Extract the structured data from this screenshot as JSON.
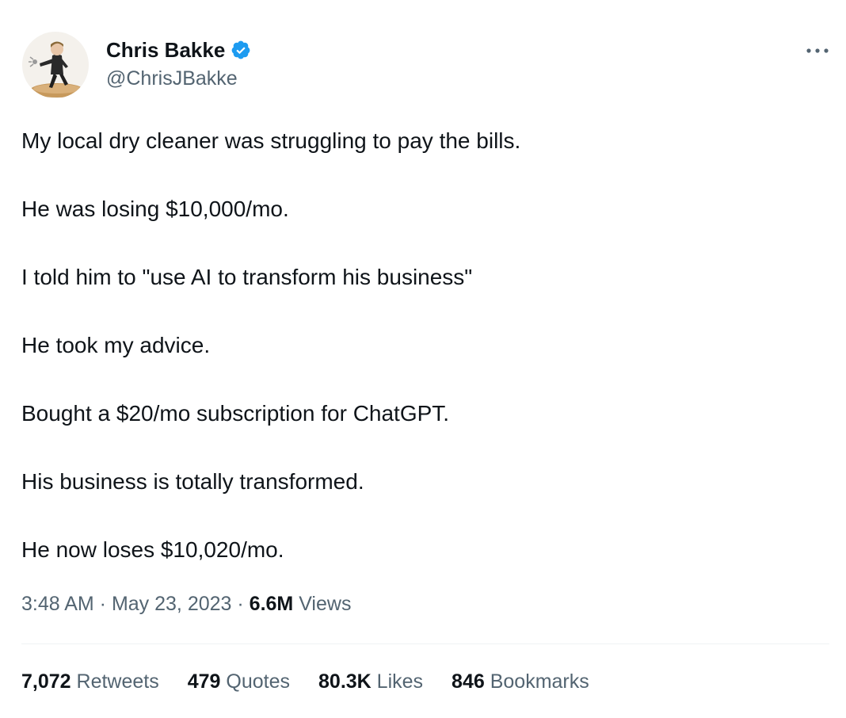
{
  "author": {
    "display_name": "Chris Bakke",
    "handle": "@ChrisJBakke",
    "verified": true,
    "verified_icon": "verified-badge-icon",
    "verified_color": "#1d9bf0"
  },
  "menu": {
    "icon": "more-icon"
  },
  "tweet": {
    "lines": [
      "My local dry cleaner was struggling to pay the bills.",
      "He was losing $10,000/mo.",
      "I told him to \"use AI to transform his business\"",
      "He took my advice.",
      "Bought a $20/mo subscription for ChatGPT.",
      "His business is totally transformed.",
      "He now loses $10,020/mo."
    ]
  },
  "meta": {
    "time": "3:48 AM",
    "separator": " · ",
    "date": "May 23, 2023",
    "views_count": "6.6M",
    "views_label": " Views"
  },
  "stats": {
    "retweets": {
      "count": "7,072",
      "label": " Retweets"
    },
    "quotes": {
      "count": "479",
      "label": " Quotes"
    },
    "likes": {
      "count": "80.3K",
      "label": " Likes"
    },
    "bookmarks": {
      "count": "846",
      "label": " Bookmarks"
    }
  },
  "colors": {
    "text_primary": "#0f1419",
    "text_secondary": "#536471",
    "divider": "#eff3f4"
  }
}
